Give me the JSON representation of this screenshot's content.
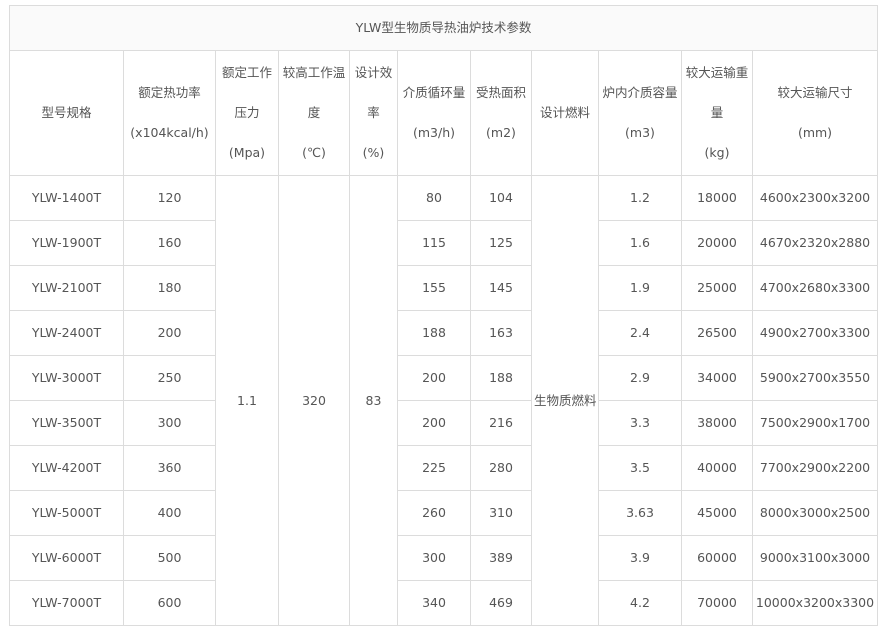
{
  "table": {
    "title": "YLW型生物质导热油炉技术参数",
    "headers": [
      [
        "型号规格"
      ],
      [
        "额定热功率",
        "(x104kcal/h)"
      ],
      [
        "额定工作",
        "压力",
        "(Mpa)"
      ],
      [
        "较高工作温",
        "度",
        "(℃)"
      ],
      [
        "设计效",
        "率",
        "(%)"
      ],
      [
        "介质循环量",
        "(m3/h)"
      ],
      [
        "受热面积",
        "(m2)"
      ],
      [
        "设计燃料"
      ],
      [
        "炉内介质容量",
        "(m3)"
      ],
      [
        "较大运输重",
        "量",
        "(kg)"
      ],
      [
        "较大运输尺寸",
        "(mm)"
      ]
    ],
    "shared": {
      "pressure": "1.1",
      "temperature": "320",
      "efficiency": "83",
      "fuel": "生物质燃料"
    },
    "rows": [
      {
        "model": "YLW-1400T",
        "power": "120",
        "flow": "80",
        "area": "104",
        "capacity": "1.2",
        "weight": "18000",
        "size": "4600x2300x3200"
      },
      {
        "model": "YLW-1900T",
        "power": "160",
        "flow": "115",
        "area": "125",
        "capacity": "1.6",
        "weight": "20000",
        "size": "4670x2320x2880"
      },
      {
        "model": "YLW-2100T",
        "power": "180",
        "flow": "155",
        "area": "145",
        "capacity": "1.9",
        "weight": "25000",
        "size": "4700x2680x3300"
      },
      {
        "model": "YLW-2400T",
        "power": "200",
        "flow": "188",
        "area": "163",
        "capacity": "2.4",
        "weight": "26500",
        "size": "4900x2700x3300"
      },
      {
        "model": "YLW-3000T",
        "power": "250",
        "flow": "200",
        "area": "188",
        "capacity": "2.9",
        "weight": "34000",
        "size": "5900x2700x3550"
      },
      {
        "model": "YLW-3500T",
        "power": "300",
        "flow": "200",
        "area": "216",
        "capacity": "3.3",
        "weight": "38000",
        "size": "7500x2900x1700"
      },
      {
        "model": "YLW-4200T",
        "power": "360",
        "flow": "225",
        "area": "280",
        "capacity": "3.5",
        "weight": "40000",
        "size": "7700x2900x2200"
      },
      {
        "model": "YLW-5000T",
        "power": "400",
        "flow": "260",
        "area": "310",
        "capacity": "3.63",
        "weight": "45000",
        "size": "8000x3000x2500"
      },
      {
        "model": "YLW-6000T",
        "power": "500",
        "flow": "300",
        "area": "389",
        "capacity": "3.9",
        "weight": "60000",
        "size": "9000x3100x3000"
      },
      {
        "model": "YLW-7000T",
        "power": "600",
        "flow": "340",
        "area": "469",
        "capacity": "4.2",
        "weight": "70000",
        "size": "10000x3200x3300"
      }
    ]
  }
}
